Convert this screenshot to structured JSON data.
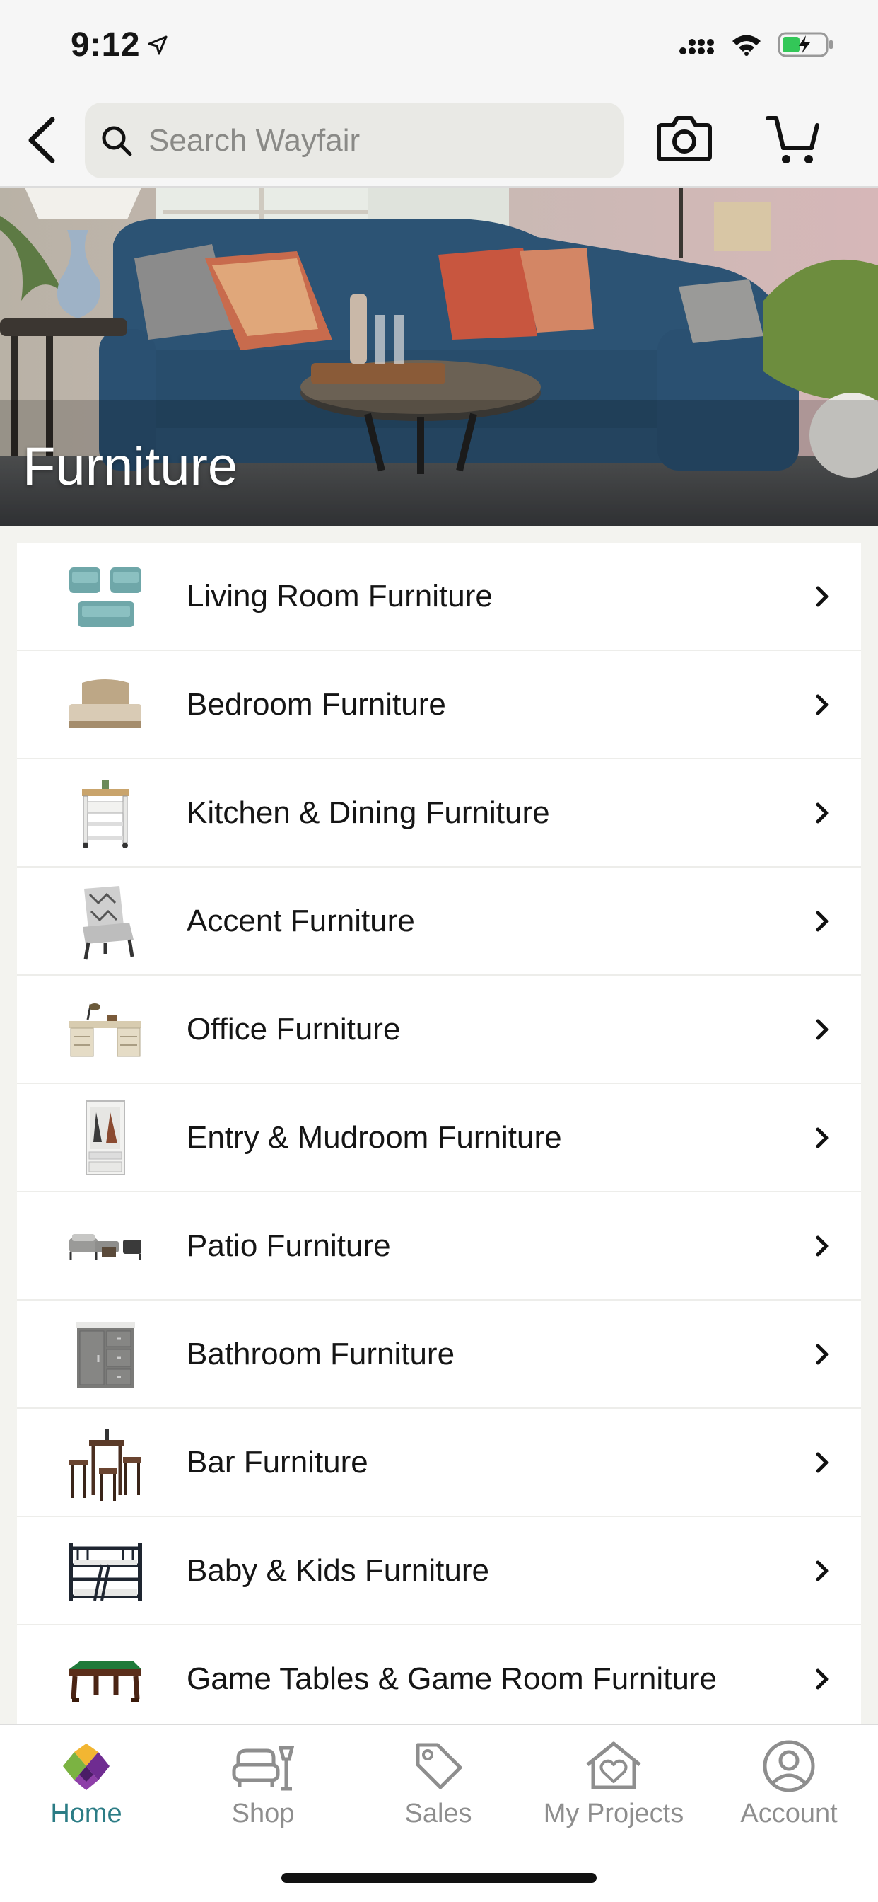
{
  "status_bar": {
    "time": "9:12",
    "battery_color": "#33c758"
  },
  "header": {
    "search_placeholder": "Search Wayfair",
    "icons": [
      "back-arrow-icon",
      "search-icon",
      "camera-icon",
      "cart-icon"
    ]
  },
  "hero": {
    "title": "Furniture"
  },
  "categories": [
    {
      "label": "Living Room Furniture",
      "thumb": "sofa-chairs-icon"
    },
    {
      "label": "Bedroom Furniture",
      "thumb": "bed-icon"
    },
    {
      "label": "Kitchen & Dining Furniture",
      "thumb": "kitchen-cart-icon"
    },
    {
      "label": "Accent Furniture",
      "thumb": "accent-chair-icon"
    },
    {
      "label": "Office Furniture",
      "thumb": "desk-icon"
    },
    {
      "label": "Entry & Mudroom Furniture",
      "thumb": "hall-tree-icon"
    },
    {
      "label": "Patio Furniture",
      "thumb": "patio-set-icon"
    },
    {
      "label": "Bathroom Furniture",
      "thumb": "vanity-icon"
    },
    {
      "label": "Bar Furniture",
      "thumb": "bar-set-icon"
    },
    {
      "label": "Baby & Kids Furniture",
      "thumb": "bunk-bed-icon"
    },
    {
      "label": "Game Tables & Game Room Furniture",
      "thumb": "pool-table-icon"
    }
  ],
  "tabs": [
    {
      "label": "Home",
      "active": true,
      "icon": "wayfair-logo-icon"
    },
    {
      "label": "Shop",
      "active": false,
      "icon": "furniture-icon"
    },
    {
      "label": "Sales",
      "active": false,
      "icon": "tag-icon"
    },
    {
      "label": "My Projects",
      "active": false,
      "icon": "heart-house-icon"
    },
    {
      "label": "Account",
      "active": false,
      "icon": "user-circle-icon"
    }
  ],
  "colors": {
    "accent": "#2b7c85",
    "inactive": "#8e8e8e"
  }
}
